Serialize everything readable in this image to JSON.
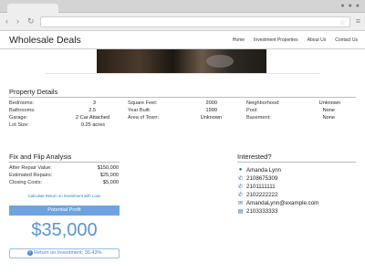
{
  "browser": {
    "nav_back": "‹",
    "nav_forward": "›",
    "nav_reload": "↻",
    "menu_icon": "≡",
    "star_icon": "☆"
  },
  "site": {
    "brand": "Wholesale Deals",
    "nav": [
      "Home",
      "Investment Properties",
      "About Us",
      "Contact Us"
    ]
  },
  "details": {
    "title": "Property Details",
    "col1": [
      {
        "label": "Bedrooms:",
        "value": "3"
      },
      {
        "label": "Bathrooms:",
        "value": "2.5"
      },
      {
        "label": "Garage:",
        "value": "2 Car Attached"
      },
      {
        "label": "Lot Size:",
        "value": "0.25 acres"
      }
    ],
    "col2": [
      {
        "label": "Square Feet:",
        "value": "2000"
      },
      {
        "label": "Year Built:",
        "value": "1990"
      },
      {
        "label": "Area of Town:",
        "value": "Unknown"
      }
    ],
    "col3": [
      {
        "label": "Neighborhood:",
        "value": "Unknown"
      },
      {
        "label": "Pool:",
        "value": "None"
      },
      {
        "label": "Basement:",
        "value": "None"
      }
    ]
  },
  "flip": {
    "title": "Fix and Flip Analysis",
    "rows": [
      {
        "label": "After Repair Value:",
        "value": "$150,000"
      },
      {
        "label": "Estimated Repairs:",
        "value": "$25,000"
      },
      {
        "label": "Closing Costs:",
        "value": "$5,000"
      }
    ],
    "loan_link": "Calculate Return on Investment with Loan",
    "profit_label": "Potential Profit",
    "profit_value": "$35,000",
    "roi_text": "Return on Investment: 30.43%",
    "accent": "#6fa2de"
  },
  "interested": {
    "title": "Interested?",
    "rows": [
      {
        "icon": "user-icon",
        "glyph": "👤",
        "text": "Amanda Lynn"
      },
      {
        "icon": "phone-icon",
        "glyph": "✆",
        "text": "2108675309"
      },
      {
        "icon": "phone-icon",
        "glyph": "✆",
        "text": "2101111111"
      },
      {
        "icon": "phone-icon",
        "glyph": "✆",
        "text": "2102222222"
      },
      {
        "icon": "envelope-icon",
        "glyph": "✉",
        "text": "AmandaLynn@example.com"
      },
      {
        "icon": "fax-icon",
        "glyph": "▤",
        "text": "2103333333"
      }
    ]
  }
}
